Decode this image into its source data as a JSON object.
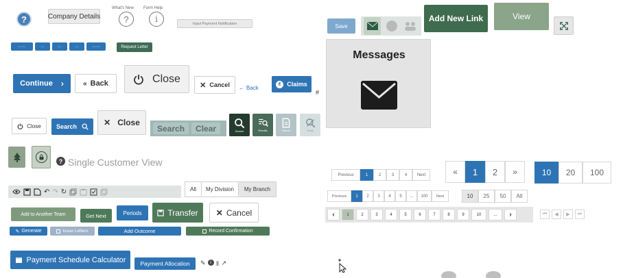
{
  "top_left": {
    "company_details": "Company Details",
    "whats_new": "What's New",
    "form_help": "Form Help",
    "input_payment": "Input  Payment Notification",
    "request_letter": "Request Letter",
    "dot_buttons": [
      "·····",
      "··",
      "··",
      "··",
      "·····"
    ]
  },
  "row_continue": {
    "continue": "Continue",
    "back": "Back",
    "close": "Close",
    "cancel": "Cancel",
    "back_link": "Back",
    "claims": "Claims"
  },
  "row_search": {
    "close_small": "Close",
    "search": "Search",
    "close_x": "Close",
    "search_gray": "Search",
    "clear_gray": "Clear",
    "tile_labels": [
      "Search",
      "Results",
      "Report",
      "Tools"
    ]
  },
  "single_customer": "Single Customer View",
  "division_tabs": [
    "All",
    "My Division",
    "My Branch"
  ],
  "action_buttons": {
    "add_team": "Add to Another Team",
    "get_next": "Get Next",
    "periods": "Periods",
    "transfer": "Transfer",
    "cancel": "Cancel",
    "generate": "Generate",
    "issue_letters": "Issue Letters",
    "add_outcome": "Add Outcome",
    "record_confirmation": "Record Confirmation",
    "payment_calc": "Payment Schedule Calculator",
    "payment_alloc": "Payment Allocation"
  },
  "right_top": {
    "save": "Save",
    "add_new_link": "Add New Link",
    "view": "View",
    "messages": "Messages"
  },
  "pagination_small": {
    "previous": "Previous",
    "pages": [
      "1",
      "2",
      "3",
      "4"
    ],
    "next": "Next"
  },
  "pagination_large": {
    "prev": "«",
    "pages": [
      "1",
      "2"
    ],
    "next": "»"
  },
  "page_sizes_large": [
    "10",
    "20",
    "100"
  ],
  "pagination_medium": {
    "previous": "Previous",
    "pages": [
      "1",
      "2",
      "3",
      "4",
      "5",
      "...",
      "100"
    ],
    "next": "Next"
  },
  "page_sizes_medium": [
    "10",
    "25",
    "50",
    "All"
  ],
  "pagination_boxed": {
    "prev": "‹",
    "pages": [
      "1",
      "2",
      "3",
      "4",
      "5",
      "6",
      "7",
      "8",
      "9",
      "10",
      "..."
    ],
    "next": "›"
  },
  "colors": {
    "primary_blue": "#2e74b5",
    "green": "#4f7a5a",
    "sage": "#8fa38c",
    "dark_green": "#2d4a3c"
  }
}
